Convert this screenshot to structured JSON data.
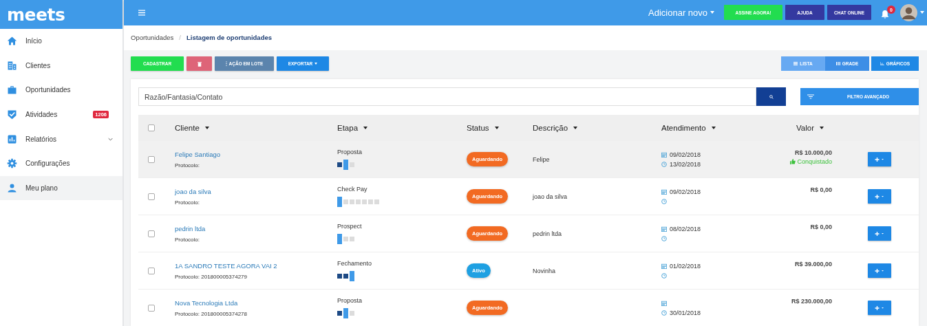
{
  "brand": "meets",
  "topbar": {
    "add_new": "Adicionar novo",
    "buttons": [
      {
        "label": "ASSINE AGORA!",
        "kind": "success"
      },
      {
        "label": "AJUDA",
        "kind": "dark"
      },
      {
        "label": "CHAT ONLINE",
        "kind": "dark"
      }
    ],
    "notifications": "0"
  },
  "sidebar": {
    "items": [
      {
        "label": "Início",
        "kind": "home",
        "selected": false,
        "has_submenu": false
      },
      {
        "label": "Clientes",
        "kind": "building",
        "selected": false,
        "has_submenu": false
      },
      {
        "label": "Oportunidades",
        "kind": "briefcase",
        "selected": false,
        "has_submenu": false
      },
      {
        "label": "Atividades",
        "kind": "check",
        "selected": false,
        "has_submenu": false,
        "badge": "1206"
      },
      {
        "label": "Relatórios",
        "kind": "chart",
        "selected": false,
        "has_submenu": true
      },
      {
        "label": "Configurações",
        "kind": "gear",
        "selected": false,
        "has_submenu": false
      },
      {
        "label": "Meu plano",
        "kind": "user",
        "selected": true,
        "has_submenu": false
      }
    ]
  },
  "breadcrumb": {
    "items": [
      "Oportunidades",
      "Listagem de oportunidades"
    ],
    "separator": "/"
  },
  "toolbar": {
    "actions": [
      {
        "label": "CADASTRAR",
        "kind": "create"
      },
      {
        "kind": "delete"
      },
      {
        "label": "AÇÃO EM LOTE",
        "kind": "batch"
      },
      {
        "label": "EXPORTAR",
        "kind": "export"
      }
    ],
    "views": [
      {
        "label": "LISTA",
        "kind": "list",
        "selected": true
      },
      {
        "label": "GRADE",
        "kind": "grid",
        "selected": false
      },
      {
        "label": "GRÁFICOS",
        "kind": "chart",
        "selected": false
      }
    ]
  },
  "search": {
    "placeholder": "Razão/Fantasia/Contato",
    "advanced_filter": "FILTRO AVANÇADO"
  },
  "table": {
    "all_checked": false,
    "columns": [
      "Cliente",
      "Etapa",
      "Status",
      "Descrição",
      "Atendimento",
      "Valor"
    ],
    "rows": [
      {
        "checked": false,
        "highlighted": true,
        "client": "Felipe Santiago",
        "protocol": "Protocolo:",
        "stage": "Proposta",
        "steps": [
          {
            "completed": true,
            "current": false
          },
          {
            "completed": false,
            "current": true
          },
          {
            "completed": false,
            "current": false
          }
        ],
        "status": "Aguardando",
        "color": "#f26a22",
        "description": "Felipe",
        "date": "09/02/2018",
        "due": "13/02/2018",
        "value": "R$ 10.000,00",
        "outcome": "Conquistado"
      },
      {
        "checked": false,
        "highlighted": false,
        "client": "joao da silva",
        "protocol": "Protocolo:",
        "stage": "Check Pay",
        "steps": [
          {
            "completed": false,
            "current": true
          },
          {
            "completed": false,
            "current": false
          },
          {
            "completed": false,
            "current": false
          },
          {
            "completed": false,
            "current": false
          },
          {
            "completed": false,
            "current": false
          },
          {
            "completed": false,
            "current": false
          },
          {
            "completed": false,
            "current": false
          }
        ],
        "status": "Aguardando",
        "color": "#f26a22",
        "description": "joao da silva",
        "date": "09/02/2018",
        "value": "R$ 0,00"
      },
      {
        "checked": false,
        "highlighted": false,
        "client": "pedrin ltda",
        "protocol": "Protocolo:",
        "stage": "Prospect",
        "steps": [
          {
            "completed": false,
            "current": true
          },
          {
            "completed": false,
            "current": false
          },
          {
            "completed": false,
            "current": false
          }
        ],
        "status": "Aguardando",
        "color": "#f26a22",
        "description": "pedrin ltda",
        "date": "08/02/2018",
        "value": "R$ 0,00"
      },
      {
        "checked": false,
        "highlighted": false,
        "client": "1A SANDRO TESTE AGORA VAI 2",
        "protocol": "Protocolo: 201800005374279",
        "stage": "Fechamento",
        "steps": [
          {
            "completed": true,
            "current": false
          },
          {
            "completed": true,
            "current": false
          },
          {
            "completed": false,
            "current": true
          }
        ],
        "status": "Ativo",
        "color": "#1ea0e2",
        "description": "Novinha",
        "date": "01/02/2018",
        "value": "R$ 39.000,00"
      },
      {
        "checked": false,
        "highlighted": false,
        "client": "Nova Tecnologia Ltda",
        "protocol": "Protocolo: 201800005374278",
        "stage": "Proposta",
        "steps": [
          {
            "completed": true,
            "current": false
          },
          {
            "completed": false,
            "current": true
          },
          {
            "completed": false,
            "current": false
          }
        ],
        "status": "Aguardando",
        "color": "#f26a22",
        "due": "30/01/2018",
        "value": "R$ 230.000,00"
      }
    ]
  }
}
